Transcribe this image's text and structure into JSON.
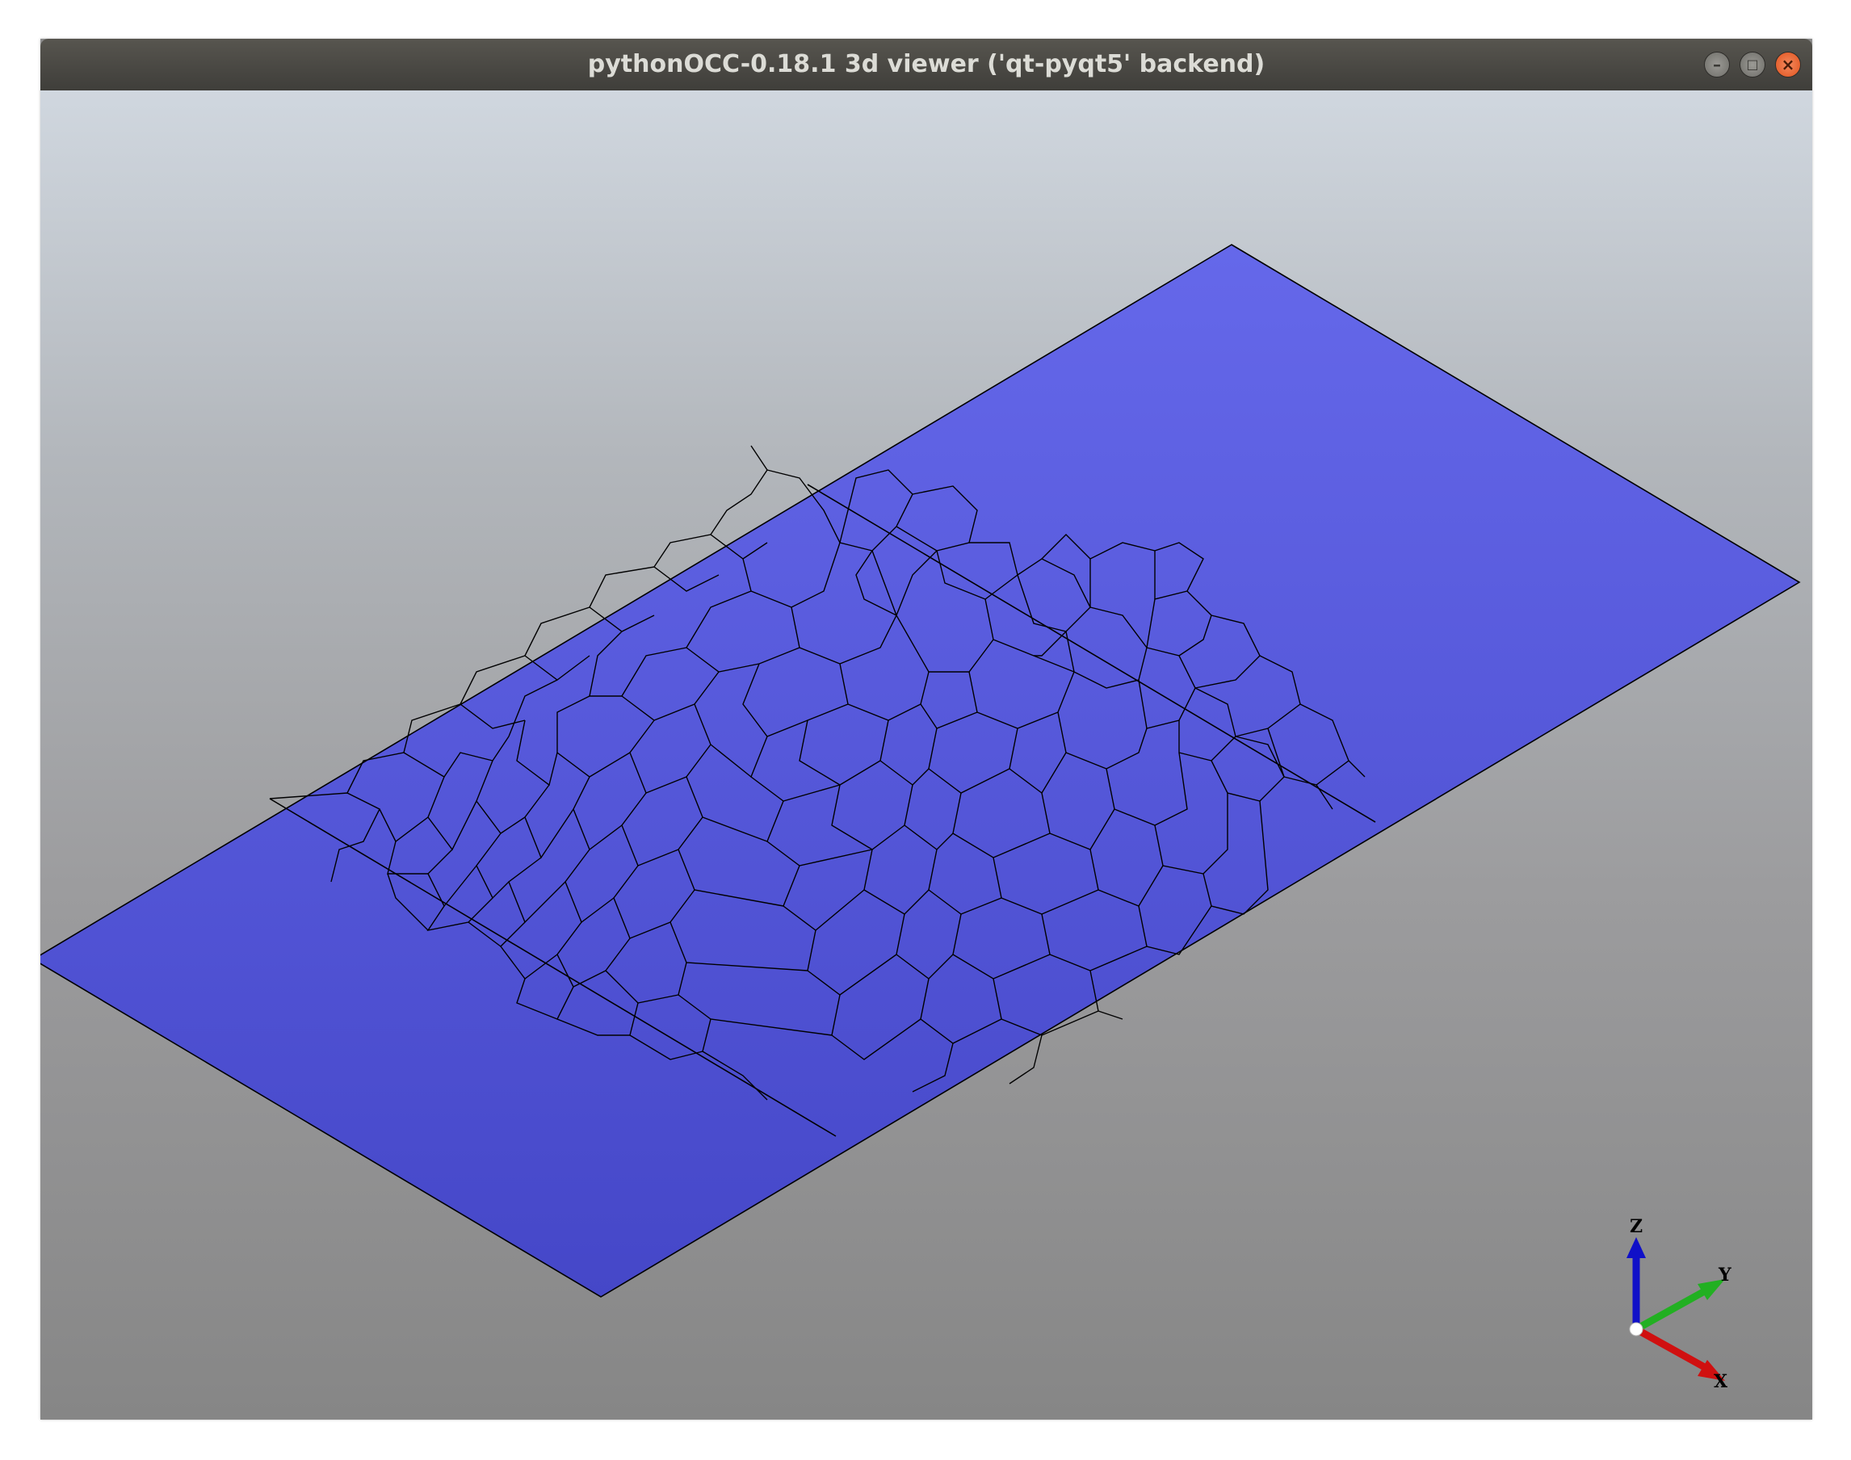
{
  "window": {
    "title": "pythonOCC-0.18.1 3d viewer ('qt-pyqt5' backend)",
    "buttons": {
      "minimize": "–",
      "maximize": "□",
      "close": "×"
    }
  },
  "viewer": {
    "background_colors": [
      "#d0d7df",
      "#868686"
    ],
    "surface_color": "#5b5ee0",
    "edge_color": "#000000",
    "triedron": {
      "z_label": "Z",
      "y_label": "Y",
      "x_label": "X",
      "z_color": "#1010c8",
      "y_color": "#22b022",
      "x_color": "#d01010"
    }
  }
}
